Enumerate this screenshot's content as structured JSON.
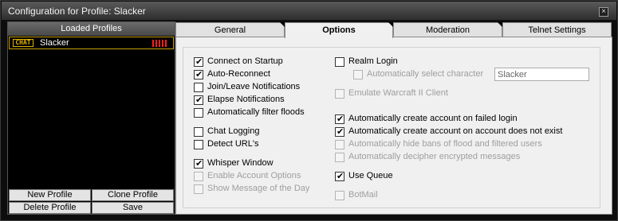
{
  "window": {
    "title": "Configuration for Profile: Slacker",
    "close_glyph": "×"
  },
  "left_panel": {
    "header": "Loaded Profiles",
    "profiles": [
      {
        "badge": "CHAT",
        "name": "Slacker",
        "signal_color": "#ff1e1e"
      }
    ],
    "buttons": {
      "new_profile": "New Profile",
      "clone_profile": "Clone Profile",
      "delete_profile": "Delete Profile",
      "save": "Save"
    }
  },
  "tabs": [
    {
      "label": "General",
      "active": false
    },
    {
      "label": "Options",
      "active": true
    },
    {
      "label": "Moderation",
      "active": false
    },
    {
      "label": "Telnet Settings",
      "active": false
    }
  ],
  "options": {
    "connect_on_startup": {
      "label": "Connect on Startup",
      "checked": true,
      "enabled": true
    },
    "auto_reconnect": {
      "label": "Auto-Reconnect",
      "checked": true,
      "enabled": true
    },
    "join_leave_notifications": {
      "label": "Join/Leave Notifications",
      "checked": false,
      "enabled": true
    },
    "elapse_notifications": {
      "label": "Elapse Notifications",
      "checked": true,
      "enabled": true
    },
    "auto_filter_floods": {
      "label": "Automatically filter floods",
      "checked": false,
      "enabled": true
    },
    "chat_logging": {
      "label": "Chat Logging",
      "checked": false,
      "enabled": true
    },
    "detect_urls": {
      "label": "Detect URL's",
      "checked": false,
      "enabled": true
    },
    "whisper_window": {
      "label": "Whisper Window",
      "checked": true,
      "enabled": true
    },
    "enable_account_options": {
      "label": "Enable Account Options",
      "checked": false,
      "enabled": false
    },
    "show_motd": {
      "label": "Show Message of the Day",
      "checked": false,
      "enabled": false
    },
    "realm_login": {
      "label": "Realm Login",
      "checked": false,
      "enabled": true
    },
    "auto_select_character": {
      "label": "Automatically select character",
      "checked": false,
      "enabled": false
    },
    "character_name": {
      "value": "Slacker"
    },
    "emulate_warcraft": {
      "label": "Emulate Warcraft  II Client",
      "checked": false,
      "enabled": false
    },
    "create_account_failed_login": {
      "label": "Automatically create account on failed login",
      "checked": true,
      "enabled": true
    },
    "create_account_not_exist": {
      "label": "Automatically create account on account does not exist",
      "checked": true,
      "enabled": true
    },
    "hide_bans": {
      "label": "Automatically hide bans of flood and filtered users",
      "checked": false,
      "enabled": false
    },
    "decipher_messages": {
      "label": "Automatically decipher encrypted messages",
      "checked": false,
      "enabled": false
    },
    "use_queue": {
      "label": "Use Queue",
      "checked": true,
      "enabled": true
    },
    "botmail": {
      "label": "BotMail",
      "checked": false,
      "enabled": false
    }
  }
}
